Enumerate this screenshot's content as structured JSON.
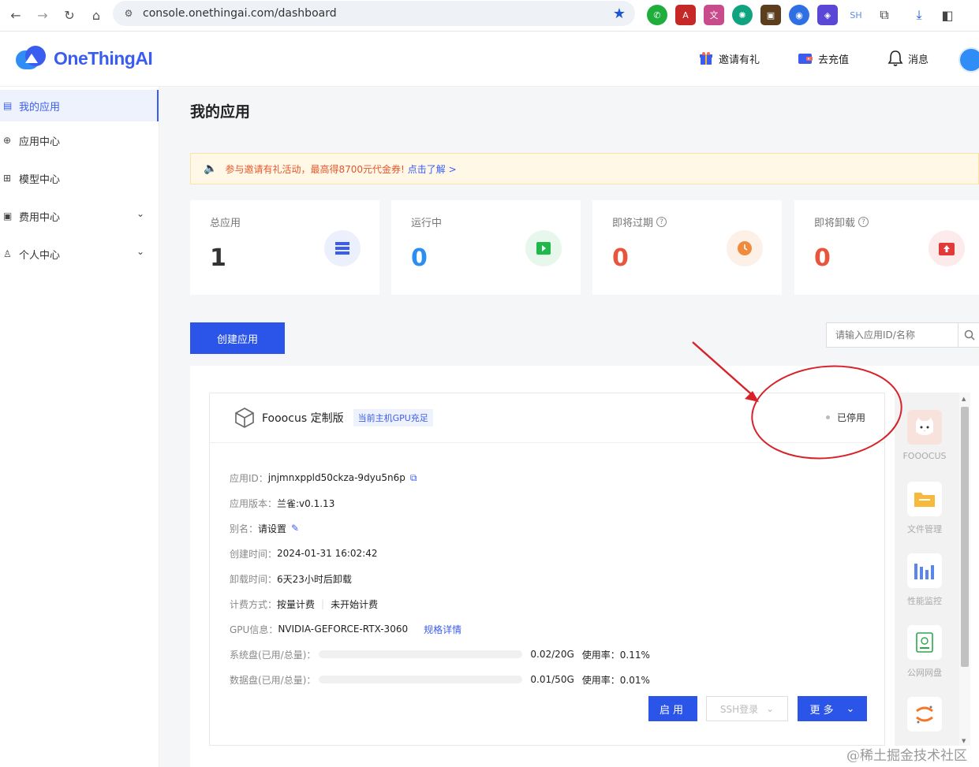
{
  "browser": {
    "url": "console.onethingai.com/dashboard",
    "ext_sh": "SH"
  },
  "header": {
    "logo_text": "OneThingAI",
    "invite": "邀请有礼",
    "recharge": "去充值",
    "messages": "消息"
  },
  "sidebar": {
    "items": [
      {
        "label": "我的应用",
        "icon": "app-grid-icon"
      },
      {
        "label": "应用中心",
        "icon": "globe-icon"
      },
      {
        "label": "模型中心",
        "icon": "grid-icon"
      },
      {
        "label": "费用中心",
        "icon": "wallet-icon"
      },
      {
        "label": "个人中心",
        "icon": "user-icon"
      }
    ]
  },
  "main": {
    "title": "我的应用",
    "notice": {
      "text": "参与邀请有礼活动，最高得8700元代金券!",
      "link": "点击了解 >"
    },
    "stats": [
      {
        "label": "总应用",
        "value": "1",
        "color": "#333333",
        "help": false,
        "icon": "list-icon"
      },
      {
        "label": "运行中",
        "value": "0",
        "color": "#2b8ef0",
        "help": false,
        "icon": "play-icon"
      },
      {
        "label": "即将过期",
        "value": "0",
        "color": "#e8543c",
        "help": true,
        "icon": "clock-icon"
      },
      {
        "label": "即将卸载",
        "value": "0",
        "color": "#e8543c",
        "help": true,
        "icon": "upload-icon"
      }
    ],
    "create_button": "创建应用",
    "search_placeholder": "请输入应用ID/名称",
    "app": {
      "name": "Fooocus 定制版",
      "gpu_tag": "当前主机GPU充足",
      "status": "已停用",
      "rows": {
        "id_key": "应用ID：",
        "id_val": "jnjmnxppld50ckza-9dyu5n6p",
        "version_key": "应用版本：",
        "version_val": "兰雀:v0.1.13",
        "alias_key": "别名：",
        "alias_val": "请设置",
        "created_key": "创建时间：",
        "created_val": "2024-01-31 16:02:42",
        "uninstall_key": "卸载时间：",
        "uninstall_val": "6天23小时后卸载",
        "billing_key": "计费方式：",
        "billing_val": "按量计费",
        "billing_state": "未开始计费",
        "gpu_key": "GPU信息：",
        "gpu_val": "NVIDIA-GEFORCE-RTX-3060",
        "gpu_link": "规格详情",
        "sysdisk_key": "系统盘(已用/总量)：",
        "sysdisk_val": "0.02/20G",
        "sysdisk_usage": "使用率：0.11%",
        "sysdisk_fraction": 0.001,
        "datadisk_key": "数据盘(已用/总量)：",
        "datadisk_val": "0.01/50G",
        "datadisk_usage": "使用率：0.01%",
        "datadisk_fraction": 0.0002
      },
      "buttons": {
        "start": "启用",
        "ssh": "SSH登录",
        "more": "更多"
      }
    },
    "tools": [
      {
        "label": "FOOOCUS",
        "icon": "cat-icon"
      },
      {
        "label": "文件管理",
        "icon": "folder-icon"
      },
      {
        "label": "性能监控",
        "icon": "bar-chart-icon"
      },
      {
        "label": "公网网盘",
        "icon": "disk-icon"
      },
      {
        "label": "",
        "icon": "jupyter-icon"
      }
    ]
  },
  "watermark": "@稀土掘金技术社区"
}
